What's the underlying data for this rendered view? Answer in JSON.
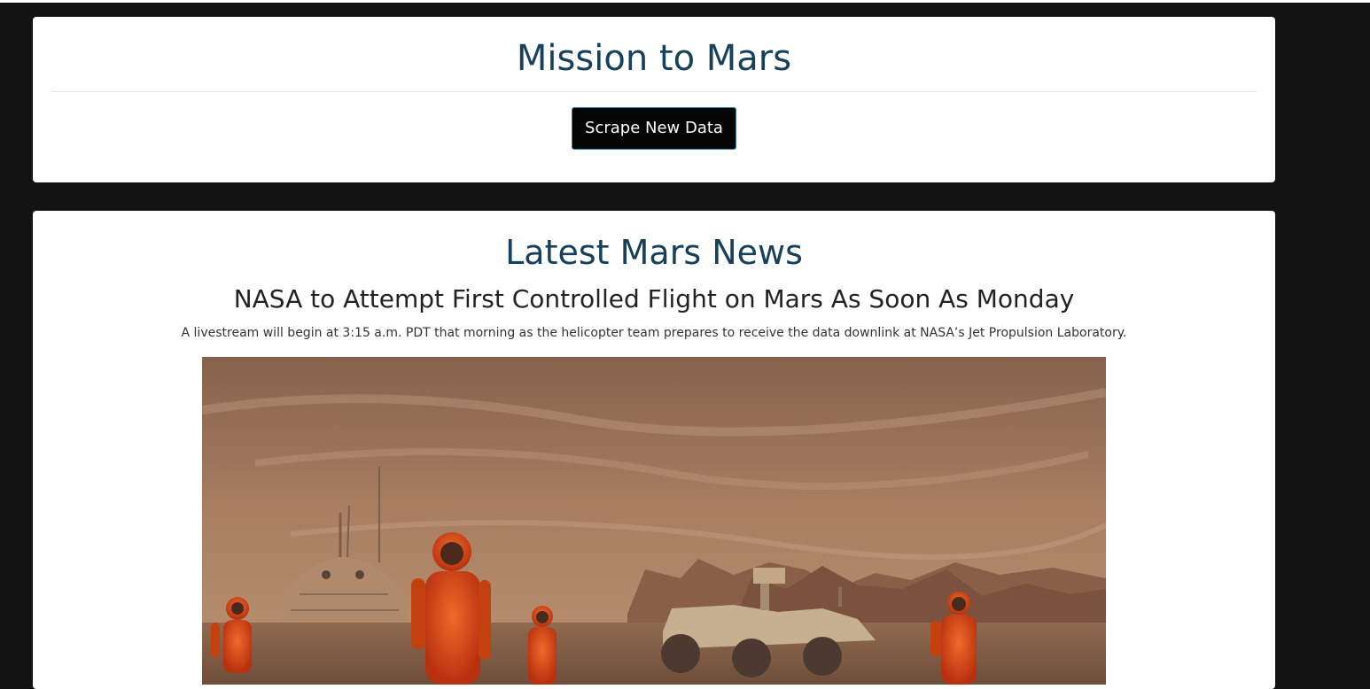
{
  "header": {
    "title": "Mission to Mars",
    "scrape_button_label": "Scrape New Data"
  },
  "news": {
    "section_title": "Latest Mars News",
    "headline": "NASA to Attempt First Controlled Flight on Mars As Soon As Monday",
    "teaser": "A livestream will begin at 3:15 a.m. PDT that morning as the helicopter team prepares to receive the data downlink at NASA’s Jet Propulsion Laboratory."
  },
  "colors": {
    "page_background": "#141314",
    "card_background": "#ffffff",
    "title_color": "#17405a",
    "button_background": "#050505",
    "button_border": "#2f7fa6"
  }
}
